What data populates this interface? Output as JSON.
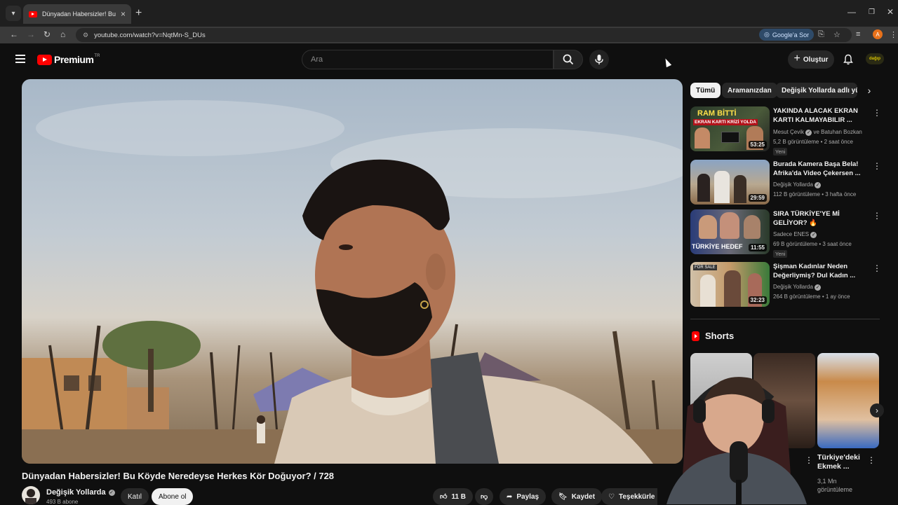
{
  "browser": {
    "tab_title": "Dünyadan Habersizler! Bu Köyde",
    "url": "youtube.com/watch?v=NqtMn-S_DUs",
    "google_sor": "Google'a Sor",
    "profile_initial": "A"
  },
  "header": {
    "logo_text": "Premium",
    "logo_region": "TR",
    "search_placeholder": "Ara",
    "create_label": "Oluştur",
    "channel_logo_text": "dağıp"
  },
  "video": {
    "title": "Dünyadan Habersizler! Bu Köyde Neredeyse Herkes Kör Doğuyor? / 728",
    "channel": "Değişik Yollarda",
    "subscribers": "493 B abone",
    "join_label": "Katıl",
    "subscribe_label": "Abone ol",
    "likes": "11 B",
    "share_label": "Paylaş",
    "save_label": "Kaydet",
    "thanks_label": "Teşekkürle"
  },
  "chips": [
    "Tümü",
    "Aramanızdan",
    "Değişik Yollarda adlı yük"
  ],
  "recommendations": [
    {
      "title": "YAKINDA ALACAK EKRAN KARTI KALMAYABILIR ...",
      "channel": "Mesut Çevik",
      "channel_extra": "ve Batuhan Bozkan",
      "stats": "5,2 B görüntüleme • 2 saat önce",
      "badge": "Yeni",
      "duration": "53:25",
      "thumb_text_1": "RAM BİTTİ",
      "thumb_text_2": "EKRAN KARTI KRİZİ YOLDA"
    },
    {
      "title": "Burada Kamera Başa Bela! Afrika'da Video Çekersen ...",
      "channel": "Değişik Yollarda",
      "stats": "112 B görüntüleme • 3 hafta önce",
      "duration": "29:59"
    },
    {
      "title": "SIRA TÜRKİYE'YE Mİ GELİYOR? 🔥",
      "channel": "Sadece ENES",
      "stats": "69 B görüntüleme • 3 saat önce",
      "badge": "Yeni",
      "duration": "11:55",
      "thumb_text_1": "TÜRKİYE HEDEF"
    },
    {
      "title": "Şişman Kadınlar Neden Değerliymiş? Dul Kadın ...",
      "channel": "Değişik Yollarda",
      "stats": "264 B görüntüleme • 1 ay önce",
      "duration": "32:23",
      "thumb_text_1": "FOR SALE"
    }
  ],
  "shorts": {
    "heading": "Shorts",
    "visible_title": "Türkiye'deki Ekmek ...",
    "visible_views": "3,1 Mn görüntüleme"
  },
  "colors": {
    "background": "#0f0f0f",
    "brand_red": "#ff0000",
    "chip_active": "#f1f1f1"
  }
}
